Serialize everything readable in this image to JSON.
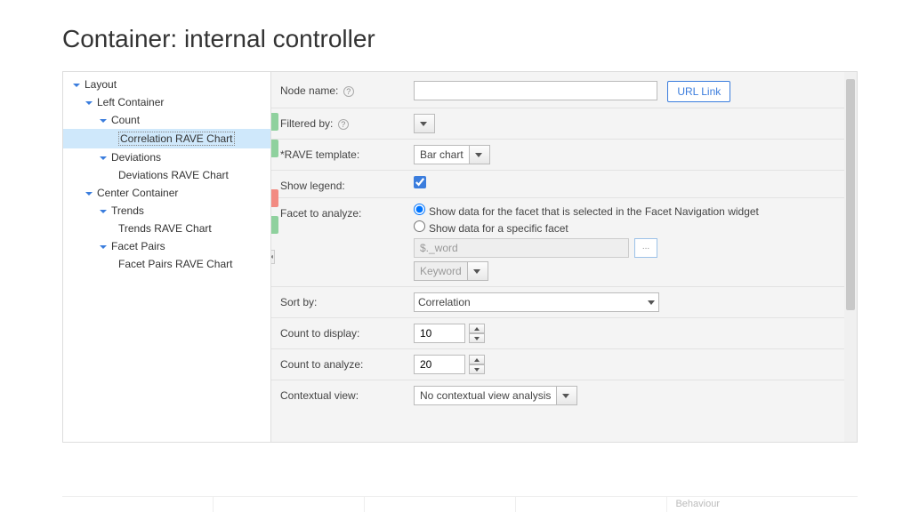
{
  "title": "Container: internal controller",
  "tree": {
    "root": "Layout",
    "left": "Left Container",
    "count": "Count",
    "corr": "Correlation RAVE Chart",
    "dev": "Deviations",
    "devchart": "Deviations RAVE Chart",
    "center": "Center Container",
    "trends": "Trends",
    "trendschart": "Trends RAVE Chart",
    "facet": "Facet Pairs",
    "facetchart": "Facet Pairs RAVE Chart"
  },
  "form": {
    "node_name_label": "Node name:",
    "url_link": "URL Link",
    "filtered_by_label": "Filtered by:",
    "rave_template_label": "*RAVE template:",
    "rave_template_value": "Bar chart",
    "show_legend_label": "Show legend:",
    "facet_analyze_label": "Facet to analyze:",
    "radio1": "Show data for the facet that is selected in the Facet Navigation widget",
    "radio2": "Show data for a specific facet",
    "facet_placeholder": "$._word",
    "keyword": "Keyword",
    "browse": "...",
    "sort_by_label": "Sort by:",
    "sort_by_value": "Correlation",
    "count_display_label": "Count to display:",
    "count_display_value": "10",
    "count_analyze_label": "Count to analyze:",
    "count_analyze_value": "20",
    "contextual_label": "Contextual view:",
    "contextual_value": "No contextual view analysis"
  },
  "footer": {
    "behaviour": "Behaviour"
  }
}
